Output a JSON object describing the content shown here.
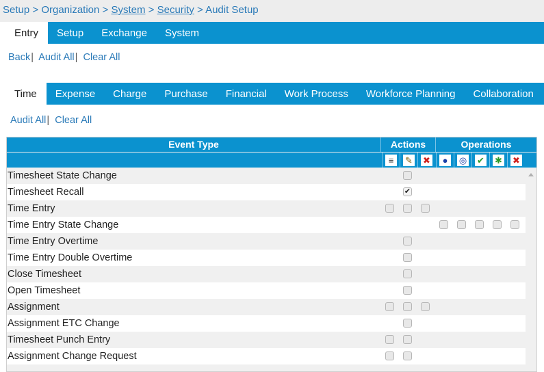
{
  "breadcrumb": {
    "items": [
      "Setup",
      "Organization",
      "System",
      "Security",
      "Audit Setup"
    ]
  },
  "top_tabs": [
    "Entry",
    "Setup",
    "Exchange",
    "System"
  ],
  "top_actions": {
    "back": "Back",
    "audit_all": "Audit All",
    "clear_all": "Clear All"
  },
  "sub_tabs": [
    "Time",
    "Expense",
    "Charge",
    "Purchase",
    "Financial",
    "Work Process",
    "Workforce Planning",
    "Collaboration"
  ],
  "sub_actions": {
    "audit_all": "Audit All",
    "clear_all": "Clear All"
  },
  "grid": {
    "headers": {
      "event_type": "Event Type",
      "actions": "Actions",
      "operations": "Operations"
    },
    "icons": [
      "list-icon",
      "edit-icon",
      "delete-icon",
      "blue-dot-icon",
      "blue-ring-icon",
      "approve-check-icon",
      "reject-icon",
      "cancel-x-icon"
    ],
    "icon_glyphs": [
      "≡",
      "✎",
      "✖",
      "●",
      "◎",
      "✔",
      "✱",
      "✖"
    ],
    "icon_colors": [
      "#333333",
      "#7a5a00",
      "#d0201c",
      "#1a3fa8",
      "#1a3fa8",
      "#2a9a2a",
      "#2a9a2a",
      "#d0201c"
    ],
    "rows": [
      {
        "label": "Timesheet State Change",
        "checks": [
          null,
          false,
          null,
          null,
          null,
          null,
          null,
          null
        ]
      },
      {
        "label": "Timesheet Recall",
        "checks": [
          null,
          true,
          null,
          null,
          null,
          null,
          null,
          null
        ]
      },
      {
        "label": "Time Entry",
        "checks": [
          false,
          false,
          false,
          null,
          null,
          null,
          null,
          null
        ]
      },
      {
        "label": "Time Entry State Change",
        "checks": [
          null,
          null,
          null,
          false,
          false,
          false,
          false,
          false
        ]
      },
      {
        "label": "Time Entry Overtime",
        "checks": [
          null,
          false,
          null,
          null,
          null,
          null,
          null,
          null
        ]
      },
      {
        "label": "Time Entry Double Overtime",
        "checks": [
          null,
          false,
          null,
          null,
          null,
          null,
          null,
          null
        ]
      },
      {
        "label": "Close Timesheet",
        "checks": [
          null,
          false,
          null,
          null,
          null,
          null,
          null,
          null
        ]
      },
      {
        "label": "Open Timesheet",
        "checks": [
          null,
          false,
          null,
          null,
          null,
          null,
          null,
          null
        ]
      },
      {
        "label": "Assignment",
        "checks": [
          false,
          false,
          false,
          null,
          null,
          null,
          null,
          null
        ]
      },
      {
        "label": "Assignment ETC Change",
        "checks": [
          null,
          false,
          null,
          null,
          null,
          null,
          null,
          null
        ]
      },
      {
        "label": "Timesheet Punch Entry",
        "checks": [
          false,
          false,
          null,
          null,
          null,
          null,
          null,
          null
        ]
      },
      {
        "label": "Assignment Change Request",
        "checks": [
          false,
          false,
          null,
          null,
          null,
          null,
          null,
          null
        ]
      }
    ]
  },
  "colors": {
    "accent": "#0b92cf",
    "link": "#2a7ab8"
  }
}
